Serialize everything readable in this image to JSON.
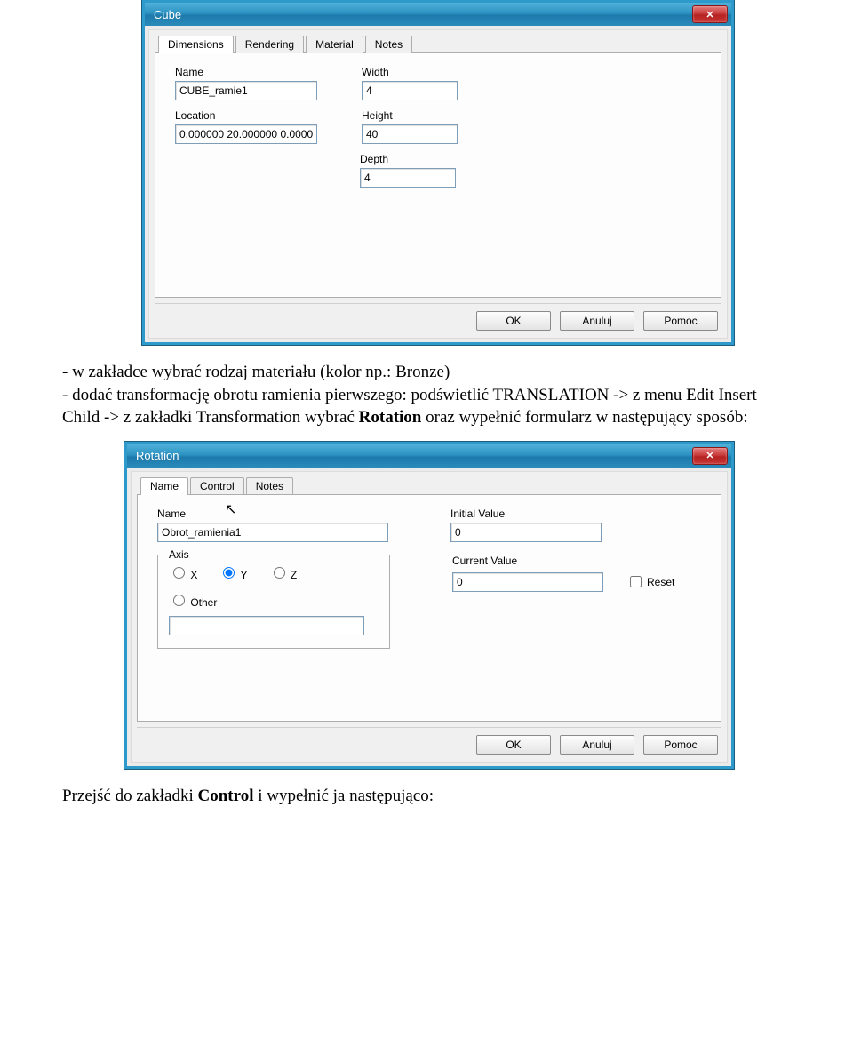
{
  "dialog1": {
    "title": "Cube",
    "tabs": [
      "Dimensions",
      "Rendering",
      "Material",
      "Notes"
    ],
    "fields": {
      "name_label": "Name",
      "name_value": "CUBE_ramie1",
      "width_label": "Width",
      "width_value": "4",
      "location_label": "Location",
      "location_value": "0.000000 20.000000 0.0000",
      "height_label": "Height",
      "height_value": "40",
      "depth_label": "Depth",
      "depth_value": "4"
    },
    "buttons": {
      "ok": "OK",
      "cancel": "Anuluj",
      "help": "Pomoc"
    }
  },
  "para1_plain_a": "- w zakładce wybrać rodzaj materiału (kolor np.: Bronze)",
  "para1_plain_b": "- dodać transformację obrotu ramienia pierwszego: podświetlić TRANSLATION -> z menu Edit Insert Child -> z zakładki Transformation wybrać ",
  "para1_bold": "Rotation",
  "para1_plain_c": " oraz wypełnić formularz w następujący sposób:",
  "dialog2": {
    "title": "Rotation",
    "tabs": [
      "Name",
      "Control",
      "Notes"
    ],
    "fields": {
      "name_label": "Name",
      "name_value": "Obrot_ramienia1",
      "init_label": "Initial Value",
      "init_value": "0",
      "axis_label": "Axis",
      "axis_x": "X",
      "axis_y": "Y",
      "axis_z": "Z",
      "axis_other": "Other",
      "cur_label": "Current Value",
      "cur_value": "0",
      "reset_label": "Reset"
    },
    "buttons": {
      "ok": "OK",
      "cancel": "Anuluj",
      "help": "Pomoc"
    }
  },
  "para2_a": "Przejść do zakładki ",
  "para2_b": "Control",
  "para2_c": " i wypełnić ja następująco:"
}
